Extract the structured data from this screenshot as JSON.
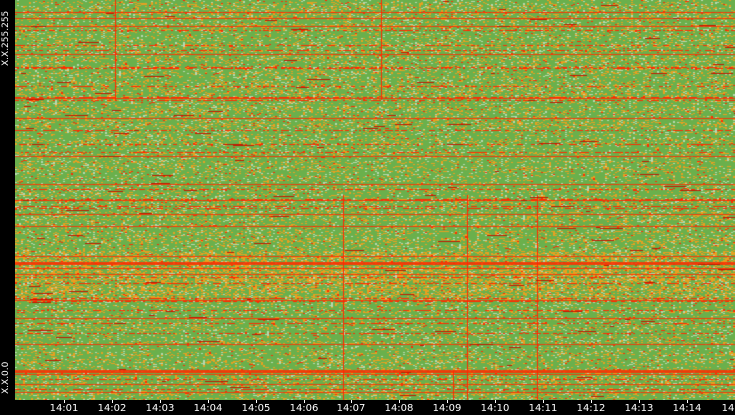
{
  "y_axis": {
    "top_label": "X.X.255.255",
    "bottom_label": "X.X.0.0"
  },
  "x_axis": {
    "ticks": [
      "14:01",
      "14:02",
      "14:03",
      "14:04",
      "14:05",
      "14:06",
      "14:07",
      "14:08",
      "14:09",
      "14:10",
      "14:11",
      "14:12",
      "14:13",
      "14:14",
      "14"
    ]
  },
  "colors": {
    "background": "#000000",
    "low": "#6ab04c",
    "mid": "#e8a020",
    "high": "#ff2a00",
    "light": "#b8d8b0"
  },
  "chart_data": {
    "type": "heatmap",
    "title": "",
    "xlabel": "",
    "ylabel": "",
    "y_range": [
      "X.X.0.0",
      "X.X.255.255"
    ],
    "x_categories": [
      "14:01",
      "14:02",
      "14:03",
      "14:04",
      "14:05",
      "14:06",
      "14:07",
      "14:08",
      "14:09",
      "14:10",
      "14:11",
      "14:12",
      "14:13",
      "14:14",
      "14"
    ]
  }
}
